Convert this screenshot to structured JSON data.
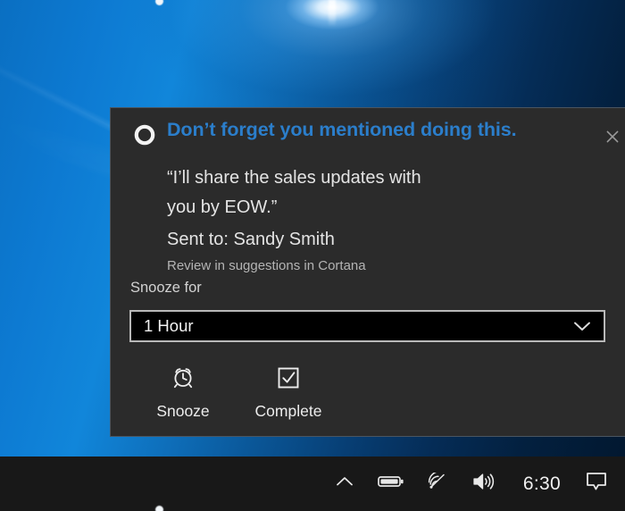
{
  "desktop": {
    "wallpaper_name": "windows-hero-light-burst",
    "base_color": "#0a5697"
  },
  "notification": {
    "app_icon": "cortana-ring-icon",
    "title": "Don’t forget you mentioned doing this.",
    "title_color": "#2b7ecb",
    "close_label": "✕",
    "quote_line_1": "“I’ll share the sales updates with",
    "quote_line_2": "you by EOW.”",
    "sent_to": "Sent to: Sandy Smith",
    "review_note": "Review in suggestions in Cortana",
    "snooze": {
      "label": "Snooze for",
      "selected_value": "1 Hour",
      "chevron_icon": "chevron-down-icon"
    },
    "actions": [
      {
        "label": "Snooze",
        "icon": "alarm-clock-icon"
      },
      {
        "label": "Complete",
        "icon": "checkbox-check-icon"
      }
    ]
  },
  "taskbar": {
    "background": "#181818",
    "tray": {
      "show_hidden_icons": "chevron-up-icon",
      "battery": "battery-icon",
      "network": "wifi-icon",
      "volume": "speaker-volume-icon",
      "clock": "6:30",
      "action_center": "action-center-icon"
    }
  }
}
